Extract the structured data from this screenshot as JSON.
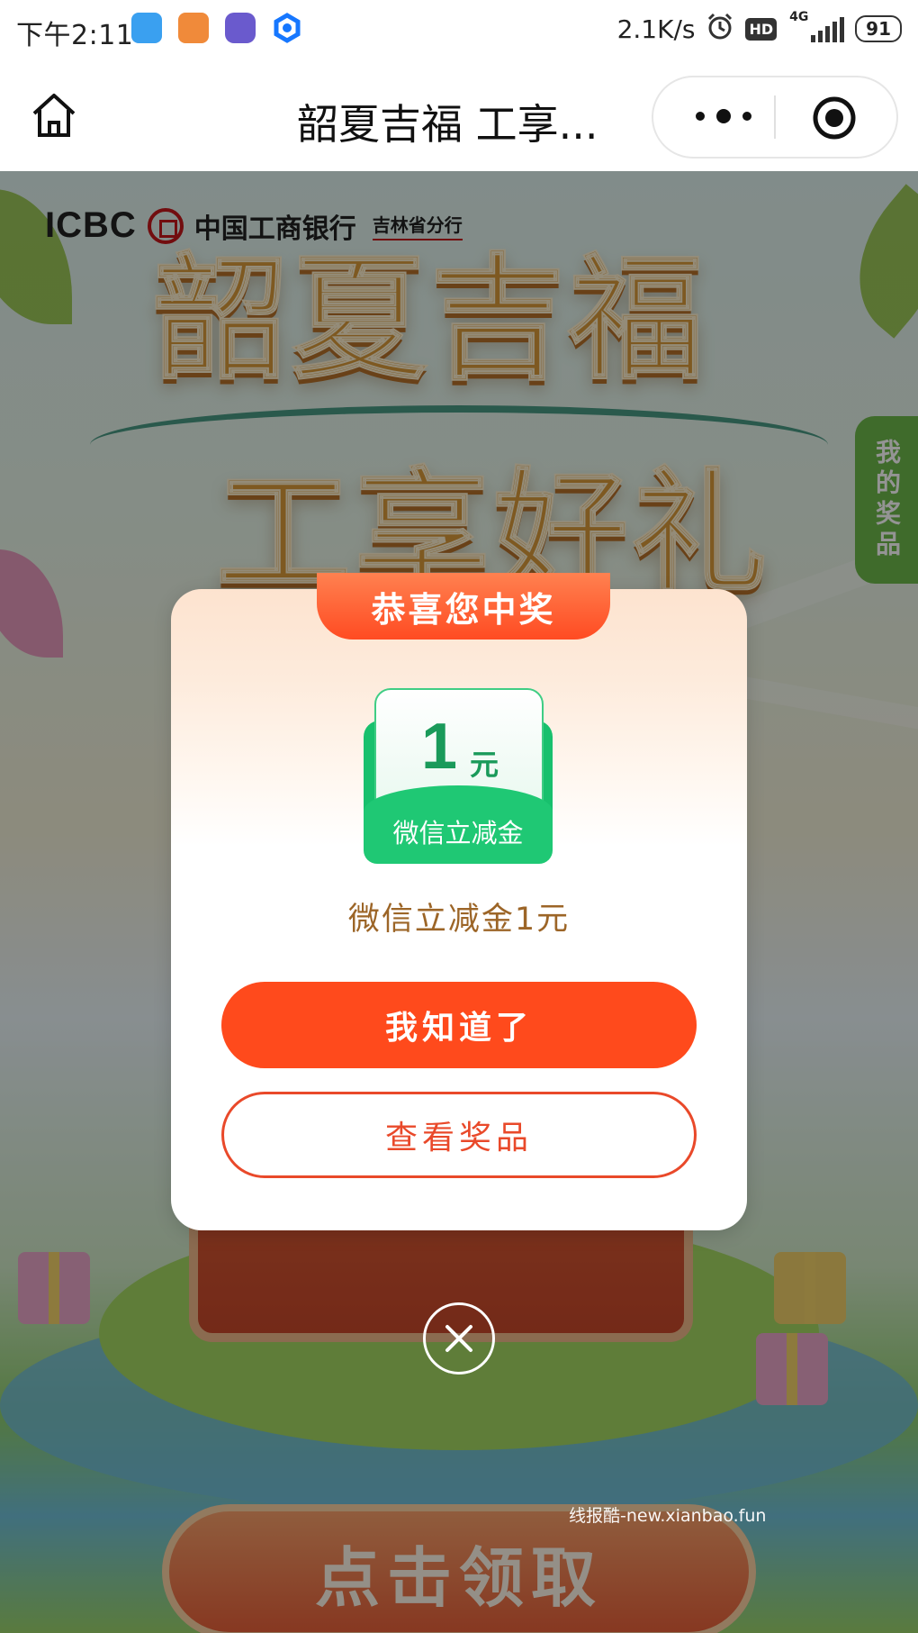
{
  "status_bar": {
    "time": "下午2:11",
    "network_speed": "2.1K/s",
    "hd_label": "HD",
    "network_type": "4G",
    "battery": "91",
    "app_icons": [
      "wallet-app-icon",
      "life-app-icon",
      "camera-app-icon",
      "browser-app-icon"
    ]
  },
  "nav": {
    "title": "韶夏吉福 工享..."
  },
  "background": {
    "bank_logo_en": "ICBC",
    "bank_name_cn": "中国工商银行",
    "branch_name": "吉林省分行",
    "hero_line1": "韶夏吉福",
    "hero_line2": "工享好礼",
    "my_prizes_tab": "我的奖品",
    "claim_button": "点击领取"
  },
  "modal": {
    "header": "恭喜您中奖",
    "coupon": {
      "amount": "1",
      "unit": "元",
      "label": "微信立减金"
    },
    "prize_text": "微信立减金1元",
    "primary_button": "我知道了",
    "secondary_button": "查看奖品"
  },
  "watermark": "线报酷-new.xianbao.fun",
  "colors": {
    "primary_orange": "#ff4a1c",
    "coupon_green": "#1fc874",
    "prize_text_brown": "#9c6527",
    "tab_green": "#6db84a"
  }
}
